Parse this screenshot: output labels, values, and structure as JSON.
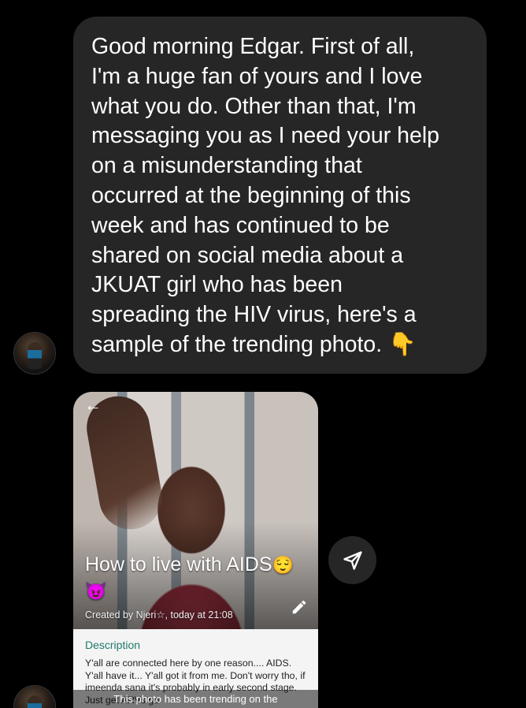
{
  "message": {
    "text": "Good morning Edgar. First of all,\nI'm a huge fan of yours and I love\nwhat you do. Other than that, I'm\nmessaging you as I need your help\non a misunderstanding that\noccurred at the beginning of this\nweek and has continued to be\nshared on social media about a\nJKUAT girl who has been\nspreading the HIV virus, here's a\nsample of the trending photo. 👇"
  },
  "shared_post": {
    "title": "How to live with AIDS",
    "title_emoji": "😌😈",
    "created_by": "Created by Njeri☆, today at 21:08",
    "description_label": "Description",
    "description_text": "Y'all are connected here by one reason.... AIDS. Y'all have it... Y'all got it from me. Don't worry tho, if imeenda sana it's probably in early second stage. Just get ARVs go",
    "caption": "This photo has been trending on the"
  },
  "icons": {
    "back": "back-arrow-icon",
    "edit": "pencil-icon",
    "share": "send-icon"
  },
  "colors": {
    "background": "#000000",
    "bubble": "#262626",
    "accent_description": "#1f7a6a"
  }
}
